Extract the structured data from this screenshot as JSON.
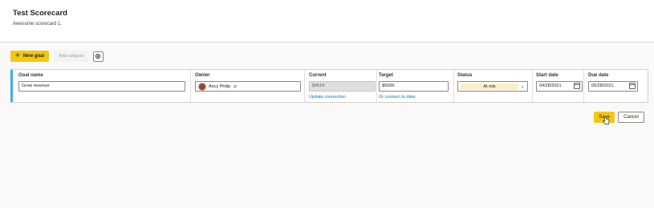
{
  "header": {
    "title": "Test Scorecard",
    "subtitle": "Awesome scorecard 1."
  },
  "toolbar": {
    "new_goal_label": "New goal",
    "add_subgoal_label": "Add subgoal"
  },
  "goal_row": {
    "goal_name": {
      "label": "Goal name",
      "value": "Grow revenue"
    },
    "owner": {
      "label": "Owner",
      "value": "Ancy Philip"
    },
    "current": {
      "label": "Current",
      "value": "$451K",
      "link": "Update connection"
    },
    "target": {
      "label": "Target",
      "value": "$500K",
      "link_prefix": "Or",
      "link": "connect to data"
    },
    "status": {
      "label": "Status",
      "value": "At risk"
    },
    "start_date": {
      "label": "Start date",
      "value": "04/28/2021"
    },
    "due_date": {
      "label": "Due date",
      "value": "05/28/2021"
    }
  },
  "actions": {
    "save_label": "Save",
    "cancel_label": "Cancel"
  },
  "colors": {
    "accent_yellow": "#f2c811",
    "row_indicator": "#3aafe8",
    "status_at_risk": "#fcefc7",
    "link": "#0078d4"
  }
}
